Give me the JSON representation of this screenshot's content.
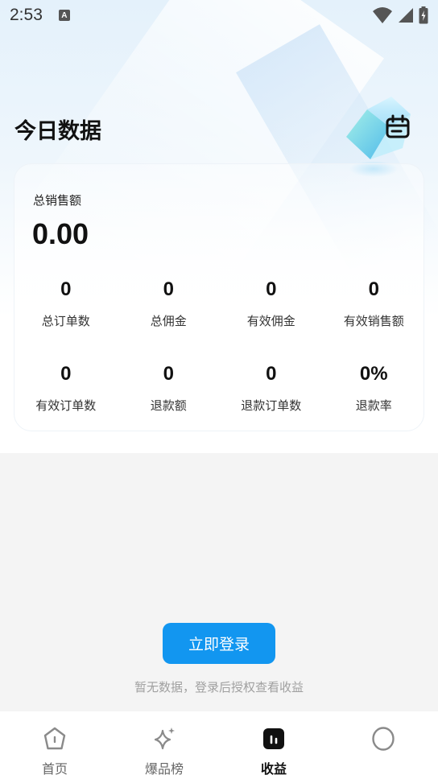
{
  "status_bar": {
    "time": "2:53",
    "notification_icon": "A"
  },
  "header": {
    "title": "今日数据",
    "calendar_icon": "calendar-icon"
  },
  "summary": {
    "label": "总销售额",
    "amount": "0.00",
    "stats": [
      {
        "value": "0",
        "label": "总订单数"
      },
      {
        "value": "0",
        "label": "总佣金"
      },
      {
        "value": "0",
        "label": "有效佣金"
      },
      {
        "value": "0",
        "label": "有效销售额"
      },
      {
        "value": "0",
        "label": "有效订单数"
      },
      {
        "value": "0",
        "label": "退款额"
      },
      {
        "value": "0",
        "label": "退款订单数"
      },
      {
        "value": "0%",
        "label": "退款率"
      }
    ]
  },
  "login": {
    "button_label": "立即登录",
    "tip": "暂无数据，登录后授权查看收益"
  },
  "tabbar": {
    "items": [
      {
        "label": "首页",
        "icon": "home-icon",
        "active": false
      },
      {
        "label": "爆品榜",
        "icon": "sparkle-icon",
        "active": false
      },
      {
        "label": "收益",
        "icon": "earnings-icon",
        "active": true
      },
      {
        "label": "",
        "icon": "profile-circle-icon",
        "active": false
      }
    ]
  },
  "colors": {
    "accent": "#1296f0",
    "tip_text": "#a0a0a0",
    "page_bg": "#f4f4f4"
  }
}
